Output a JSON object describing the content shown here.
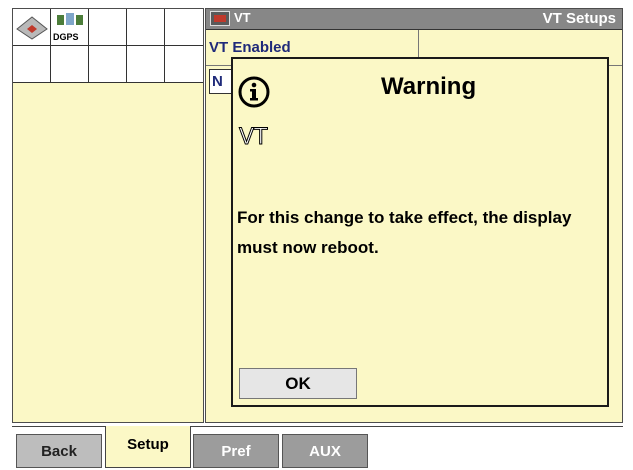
{
  "status": {
    "gps_label": "DGPS"
  },
  "vt_screen": {
    "window_label": "VT",
    "title": "VT Setups",
    "field_label": "VT Enabled",
    "field_value": "N",
    "icon": "vt-screen-icon"
  },
  "dialog": {
    "title": "Warning",
    "icon": "info-icon",
    "vt_logo_text": "VT",
    "message": "For this change to take effect, the display must now reboot.",
    "ok_label": "OK"
  },
  "tabs": [
    {
      "label": "Back",
      "active": false
    },
    {
      "label": "Setup",
      "active": true
    },
    {
      "label": "Pref",
      "active": false
    },
    {
      "label": "AUX",
      "active": false
    }
  ],
  "colors": {
    "panel_background": "#fbf8c6",
    "title_bar": "#878787",
    "label_text": "#1f2a7a",
    "tab_inactive": "#9c9c9c"
  }
}
